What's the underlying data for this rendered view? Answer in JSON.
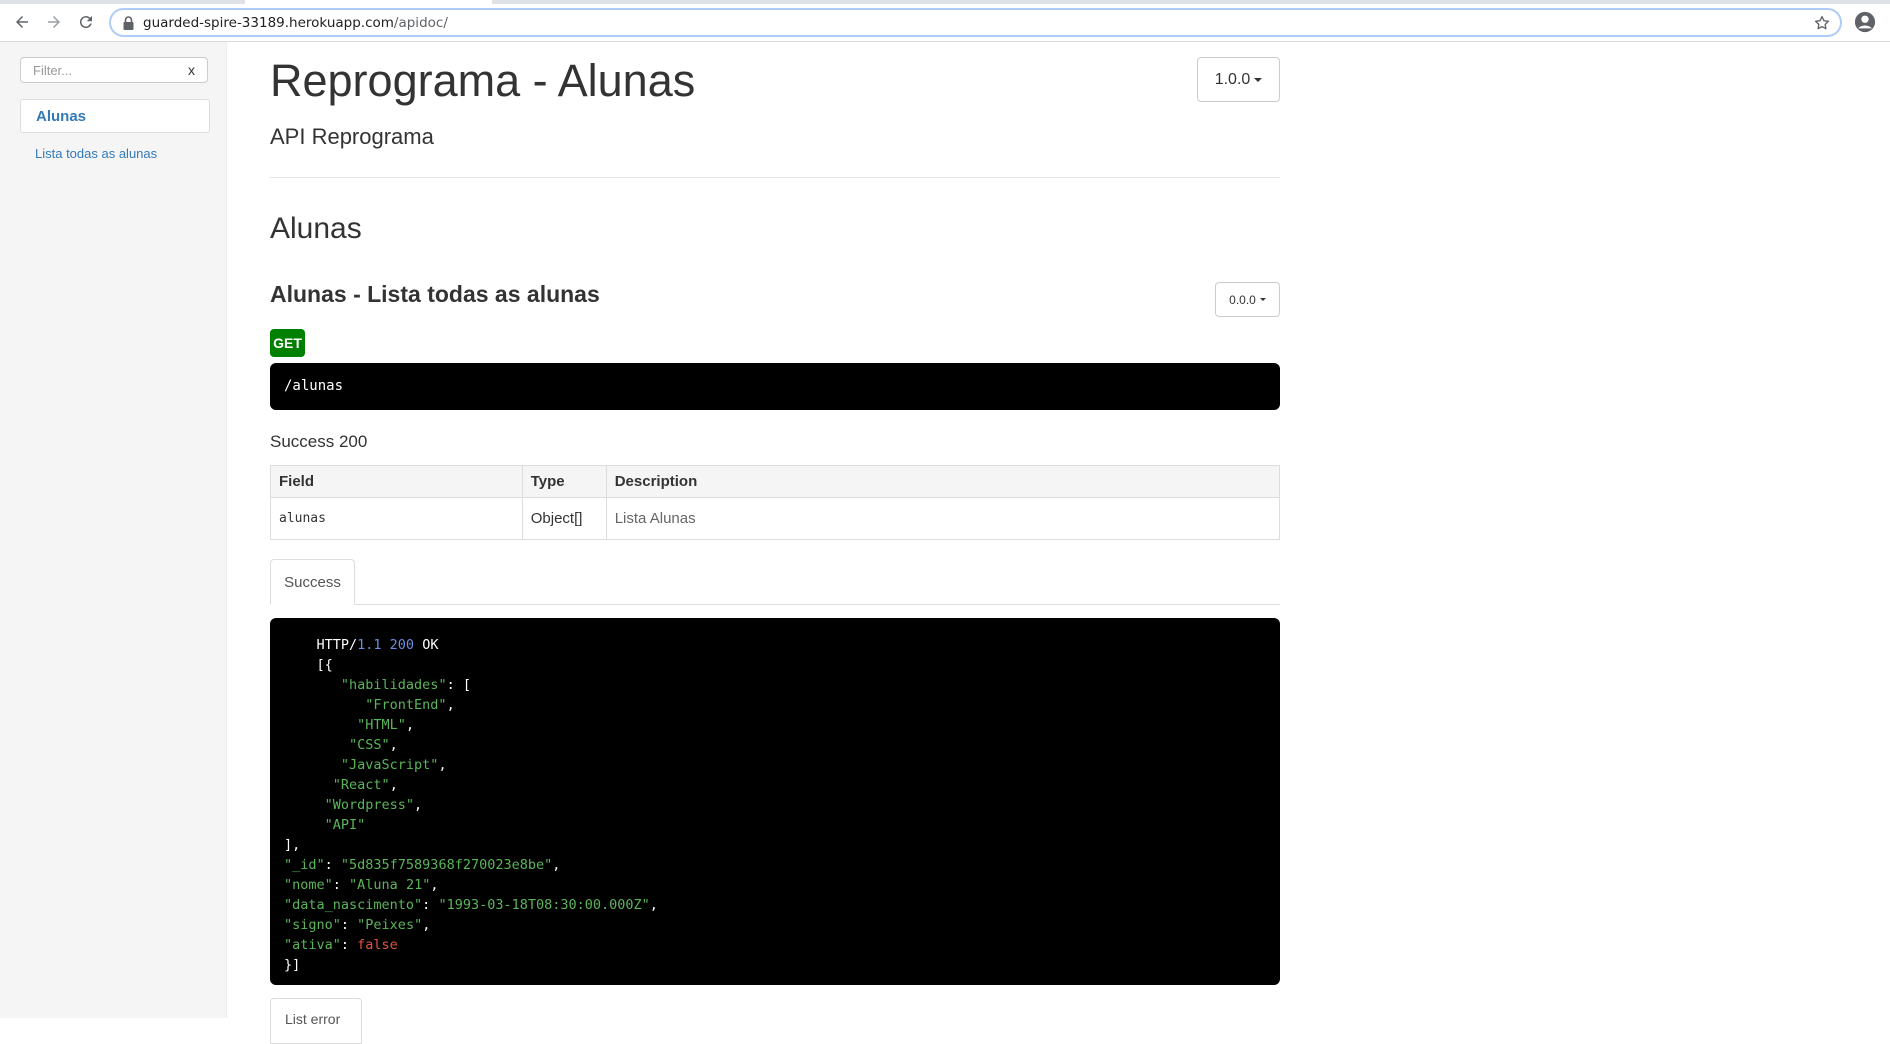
{
  "browser": {
    "url_host": "guarded-spire-33189.herokuapp.com",
    "url_path": "/apidoc/"
  },
  "sidebar": {
    "filter_placeholder": "Filter...",
    "filter_clear": "x",
    "group_label": "Alunas",
    "items": [
      {
        "label": "Lista todas as alunas"
      }
    ]
  },
  "header": {
    "title": "Reprograma - Alunas",
    "version": "1.0.0",
    "subtitle": "API Reprograma"
  },
  "section": {
    "title": "Alunas"
  },
  "article": {
    "title": "Alunas - Lista todas as alunas",
    "version": "0.0.0",
    "method": "GET",
    "endpoint": "/alunas",
    "success_heading": "Success 200",
    "table": {
      "headers": [
        "Field",
        "Type",
        "Description"
      ],
      "rows": [
        {
          "field": "alunas",
          "type": "Object[]",
          "description": "Lista Alunas"
        }
      ]
    },
    "tab_label": "Success",
    "example": {
      "http": "HTTP/",
      "version_num": "1.1 200",
      "status": " OK",
      "habilidades_key": "\"habilidades\"",
      "skills": [
        "\"FrontEnd\"",
        "\"HTML\"",
        "\"CSS\"",
        "\"JavaScript\"",
        "\"React\"",
        "\"Wordpress\"",
        "\"API\""
      ],
      "id_key": "\"_id\"",
      "id_val": "\"5d835f7589368f270023e8be\"",
      "nome_key": "\"nome\"",
      "nome_val": "\"Aluna 21\"",
      "data_key": "\"data_nascimento\"",
      "data_val": "\"1993-03-18T08:30:00.000Z\"",
      "signo_key": "\"signo\"",
      "signo_val": "\"Peixes\"",
      "ativa_key": "\"ativa\"",
      "ativa_val": "false"
    },
    "next_tab_label": "List error"
  },
  "colors": {
    "link": "#337ab7",
    "get_badge": "#008000",
    "code_bg": "#000000",
    "code_string": "#5ab55a",
    "code_number": "#6b8fe0",
    "code_boolean": "#e0563d"
  },
  "icons": [
    "back-arrow-icon",
    "forward-arrow-icon",
    "reload-icon",
    "lock-icon",
    "star-icon",
    "profile-icon"
  ]
}
